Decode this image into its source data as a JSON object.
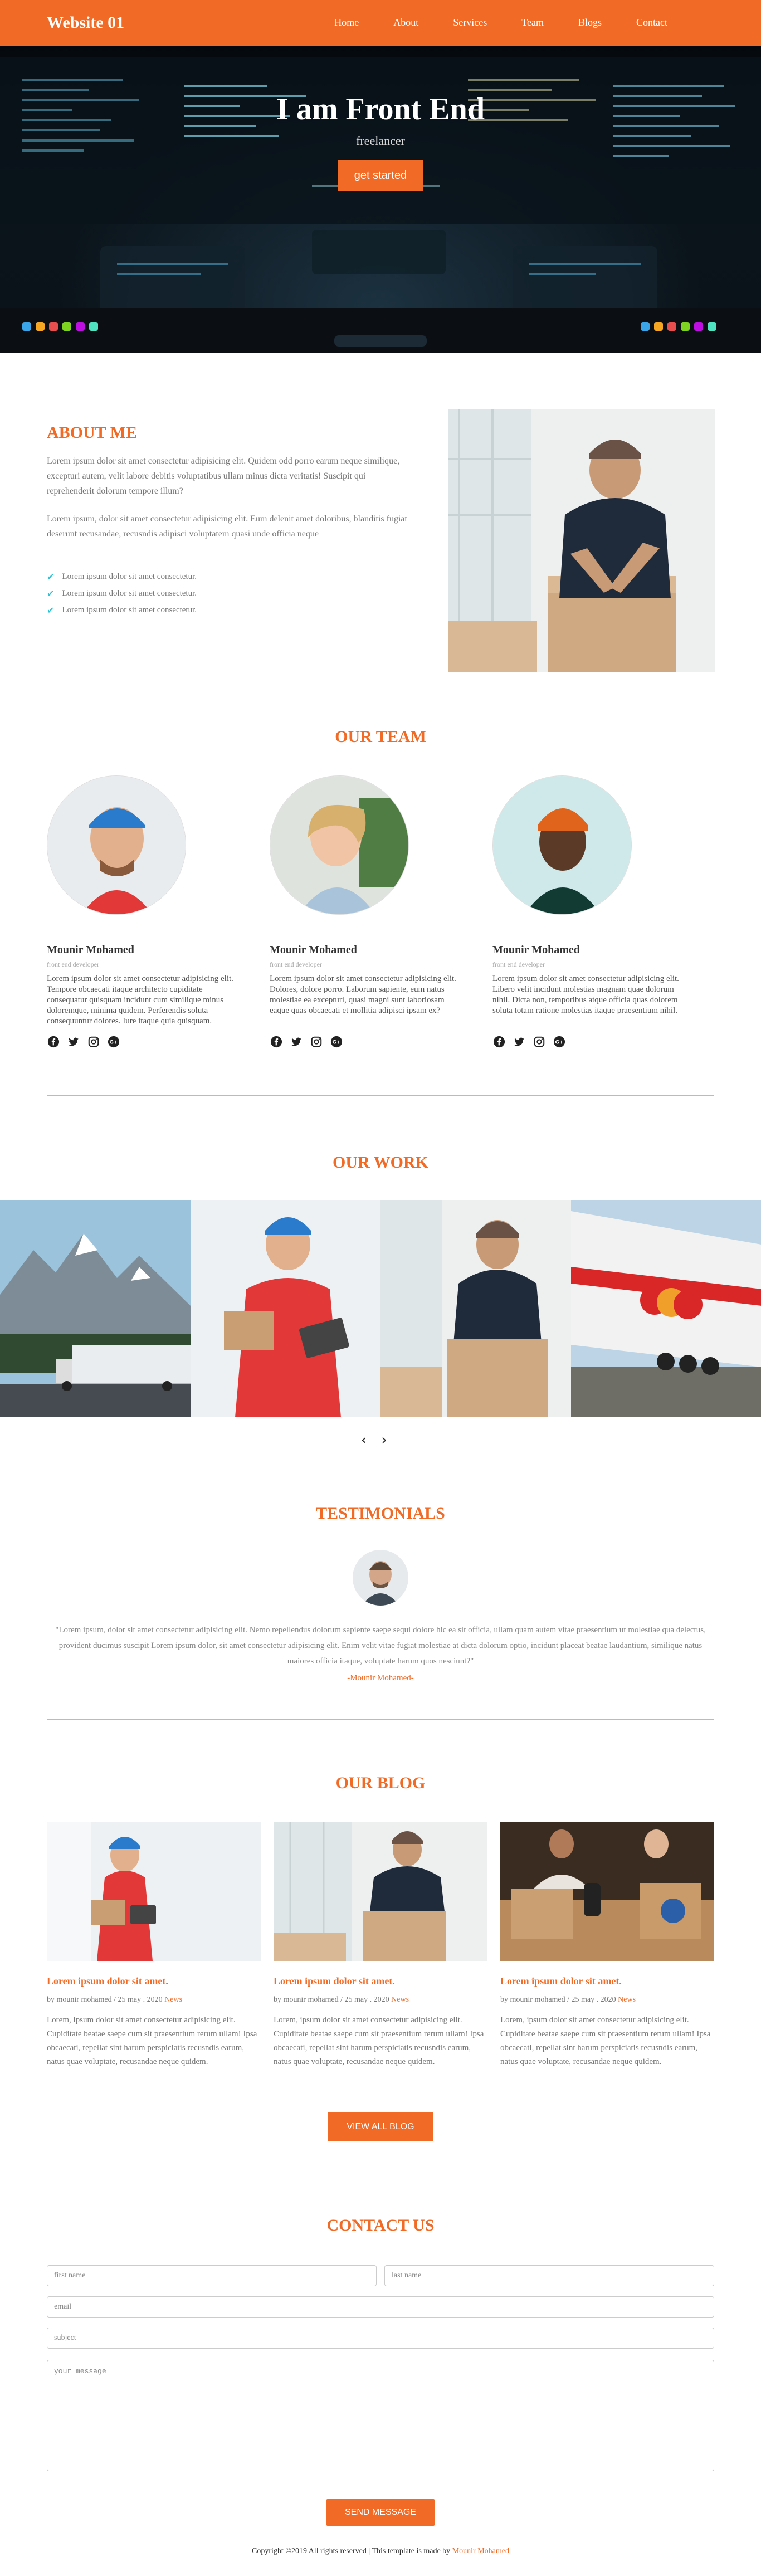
{
  "nav": {
    "brand": "Website 01",
    "items": [
      {
        "label": "Home"
      },
      {
        "label": "About"
      },
      {
        "label": "Services"
      },
      {
        "label": "Team"
      },
      {
        "label": "Blogs"
      },
      {
        "label": "Contact"
      }
    ]
  },
  "hero": {
    "title": "I am Front End",
    "subtitle": "freelancer",
    "cta": "get started"
  },
  "about": {
    "title": "ABOUT ME",
    "p1": "Lorem ipsum dolor sit amet consectetur adipisicing elit. Quidem odd porro earum neque similique, excepturi autem, velit labore debitis voluptatibus ullam minus dicta veritatis! Suscipit qui reprehenderit dolorum tempore illum?",
    "p2": "Lorem ipsum, dolor sit amet consectetur adipisicing elit. Eum delenit amet doloribus, blanditis fugiat deserunt recusandae, recusndis adipisci voluptatem quasi unde officia neque",
    "checks": [
      "Lorem ipsum dolor sit amet consectetur.",
      "Lorem ipsum dolor sit amet consectetur.",
      "Lorem ipsum dolor sit amet consectetur."
    ]
  },
  "team": {
    "title": "OUR TEAM",
    "members": [
      {
        "name": "Mounir Mohamed",
        "role": "front end developer",
        "bio": "Lorem ipsum dolor sit amet consectetur adipisicing elit. Tempore obcaecati itaque architecto cupiditate consequatur quisquam incidunt cum similique minus doloremque, minima quidem. Perferendis soluta consequuntur dolores. Iure itaque quia quisquam."
      },
      {
        "name": "Mounir Mohamed",
        "role": "front end developer",
        "bio": "Lorem ipsum dolor sit amet consectetur adipisicing elit. Dolores, dolore porro. Laborum sapiente, eum natus molestiae ea excepturi, quasi magni sunt laboriosam eaque quas obcaecati et mollitia adipisci ipsam ex?"
      },
      {
        "name": "Mounir Mohamed",
        "role": "front end developer",
        "bio": "Lorem ipsum dolor sit amet consectetur adipisicing elit. Libero velit incidunt molestias magnam quae dolorum nihil. Dicta non, temporibus atque officia quas dolorem soluta totam ratione molestias itaque praesentium nihil."
      }
    ]
  },
  "work": {
    "title": "OUR WORK",
    "prev": "‹",
    "next": "›"
  },
  "testimonials": {
    "title": "TESTIMONIALS",
    "quote": "\"Lorem ipsum, dolor sit amet consectetur adipisicing elit. Nemo repellendus dolorum sapiente saepe sequi dolore hic ea sit officia, ullam quam autem vitae praesentium ut molestiae qua delectus, provident ducimus suscipit Lorem ipsum dolor, sit amet consectetur adipisicing elit. Enim velit vitae fugiat molestiae at dicta dolorum optio, incidunt placeat beatae laudantium, similique natus maiores officia itaque, voluptate harum quos nesciunt?\"",
    "author": "-Mounir Mohamed-"
  },
  "blog": {
    "title": "OUR BLOG",
    "posts": [
      {
        "title": "Lorem ipsum dolor sit amet.",
        "meta": "by mounir mohamed / 25 may . 2020",
        "category": "News",
        "excerpt": "Lorem, ipsum dolor sit amet consectetur adipisicing elit. Cupiditate beatae saepe cum sit praesentium rerum ullam! Ipsa obcaecati, repellat sint harum perspiciatis recusndis earum, natus quae voluptate, recusandae neque quidem."
      },
      {
        "title": "Lorem ipsum dolor sit amet.",
        "meta": "by mounir mohamed / 25 may . 2020",
        "category": "News",
        "excerpt": "Lorem, ipsum dolor sit amet consectetur adipisicing elit. Cupiditate beatae saepe cum sit praesentium rerum ullam! Ipsa obcaecati, repellat sint harum perspiciatis recusndis earum, natus quae voluptate, recusandae neque quidem."
      },
      {
        "title": "Lorem ipsum dolor sit amet.",
        "meta": "by mounir mohamed / 25 may . 2020",
        "category": "News",
        "excerpt": "Lorem, ipsum dolor sit amet consectetur adipisicing elit. Cupiditate beatae saepe cum sit praesentium rerum ullam! Ipsa obcaecati, repellat sint harum perspiciatis recusndis earum, natus quae voluptate, recusandae neque quidem."
      }
    ],
    "view_all": "VIEW ALL BLOG"
  },
  "contact": {
    "title": "CONTACT US",
    "first_name_placeholder": "first name",
    "last_name_placeholder": "last name",
    "email_placeholder": "email",
    "subject_placeholder": "subject",
    "message_placeholder": "your message",
    "send": "SEND MESSAGE"
  },
  "footer": {
    "text": "Copyright ©2019 All rights reserved | This template is made by ",
    "maker": "Mounir Mohamed"
  },
  "colors": {
    "accent": "#f16b26",
    "check": "#2bc4d8"
  }
}
